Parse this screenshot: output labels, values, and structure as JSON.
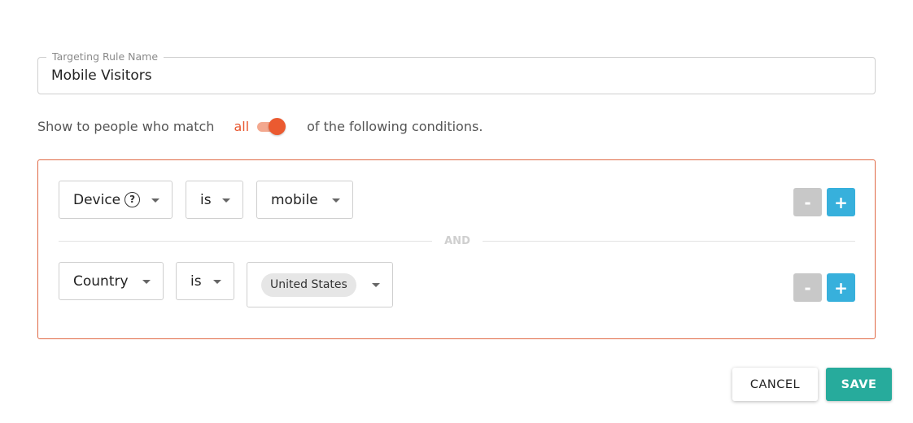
{
  "rule_name": {
    "legend": "Targeting Rule Name",
    "value": "Mobile Visitors"
  },
  "match": {
    "prefix": "Show to people who match",
    "mode": "all",
    "suffix": "of the following conditions.",
    "toggle_on": true
  },
  "conditions": [
    {
      "field": "Device",
      "field_has_help_icon": true,
      "operator": "is",
      "value": "mobile"
    },
    {
      "field": "Country",
      "operator": "is",
      "chip": "United States"
    }
  ],
  "joiner": "AND",
  "controls": {
    "remove_label": "-",
    "add_label": "+"
  },
  "actions": {
    "cancel": "CANCEL",
    "save": "SAVE"
  },
  "colors": {
    "accent": "#eb5a30",
    "add_button": "#37b0dc",
    "save_button": "#27ab9c",
    "condition_border": "#e06a46"
  },
  "icons": {
    "help": "help-circle-icon",
    "dropdown": "caret-down-icon"
  }
}
